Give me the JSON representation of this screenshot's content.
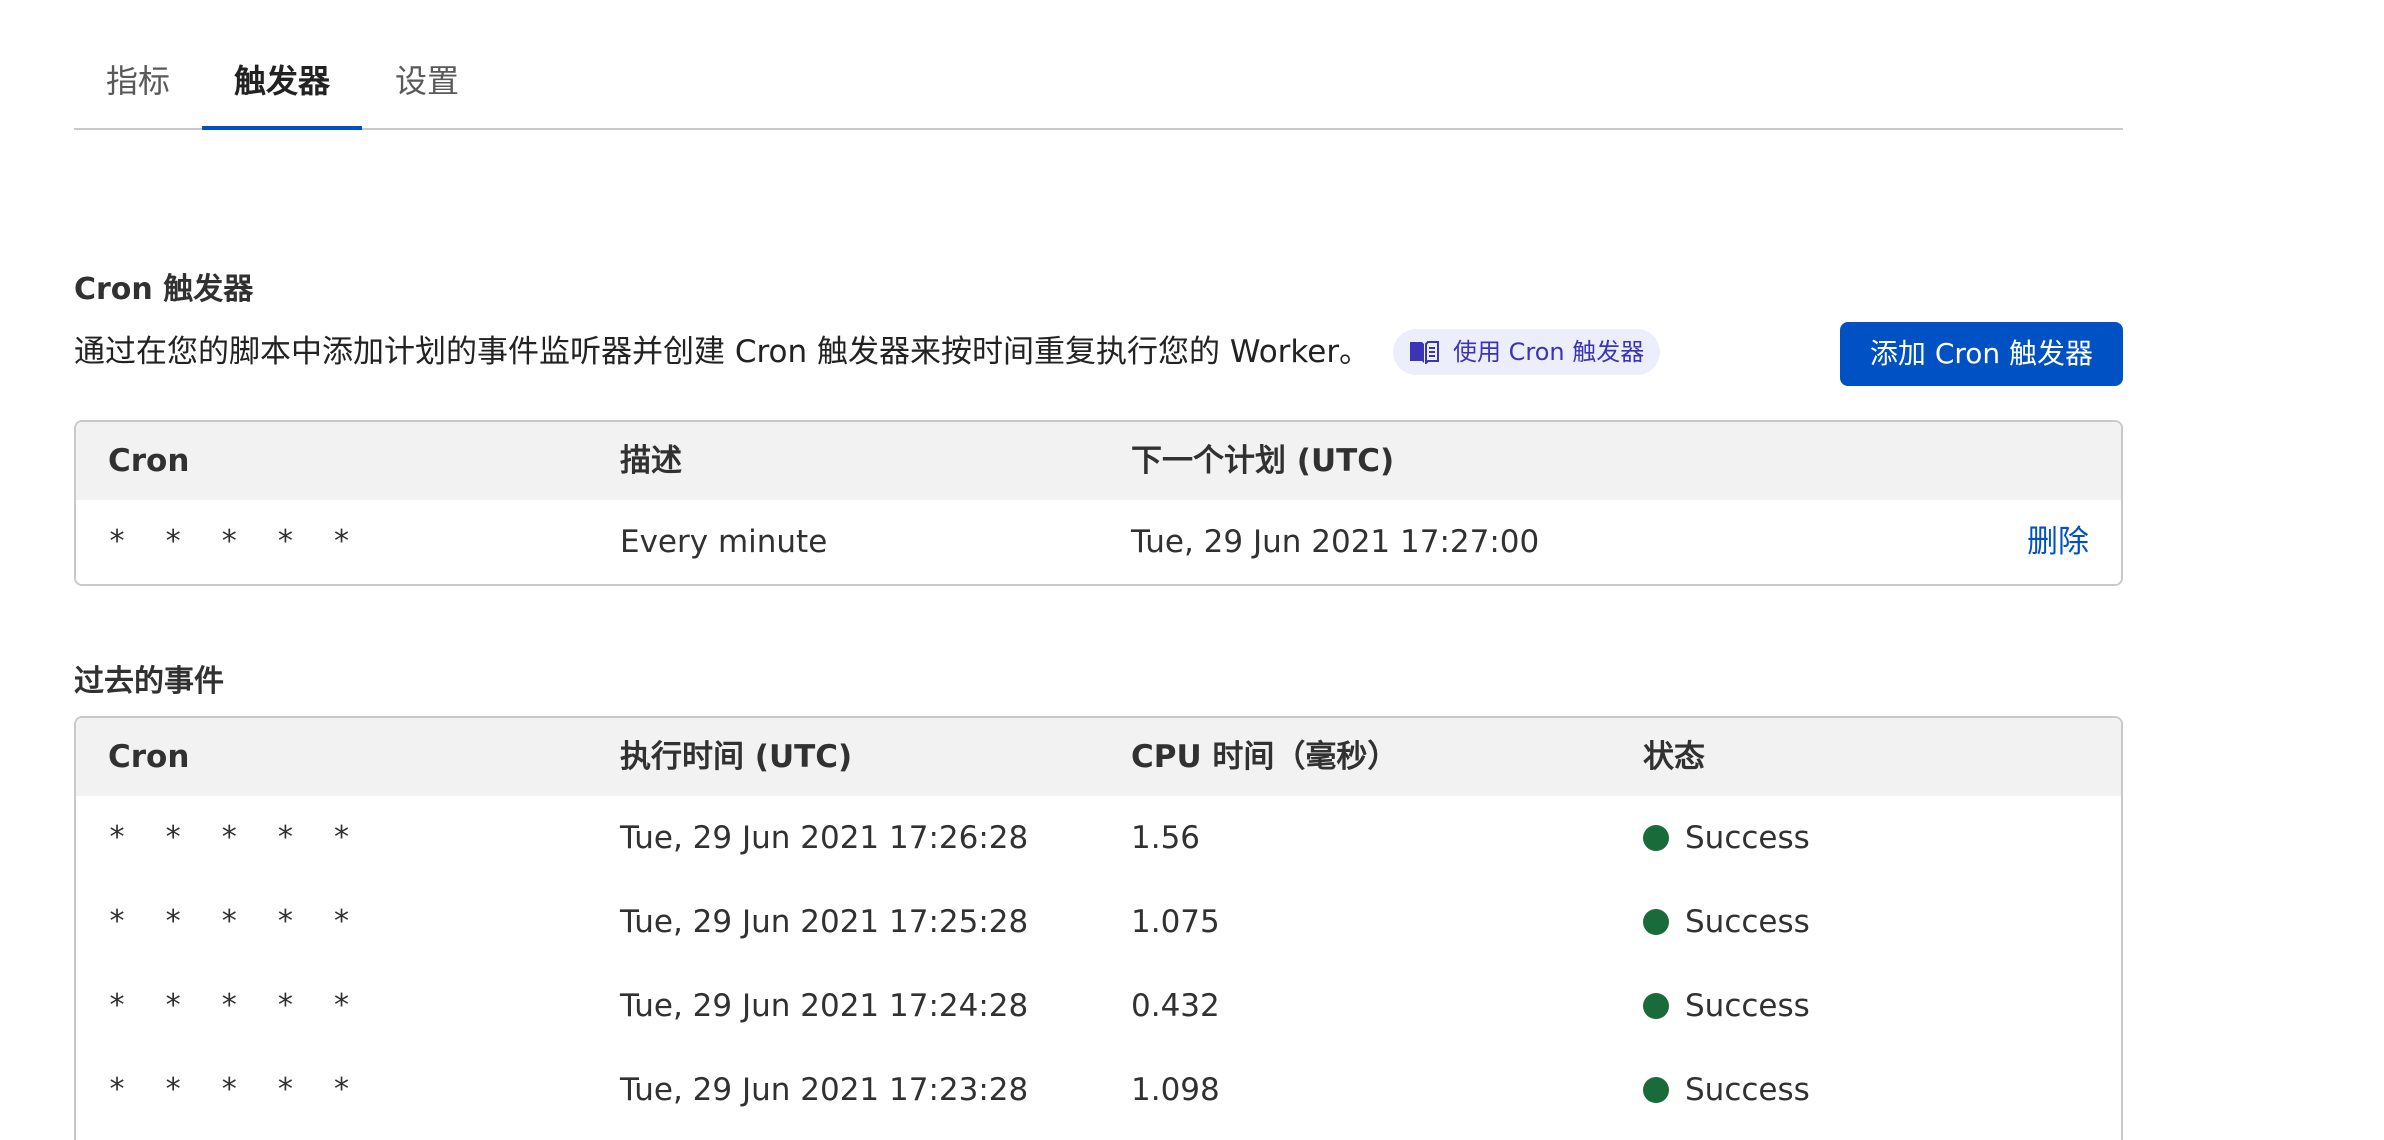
{
  "tabs": [
    {
      "label": "指标"
    },
    {
      "label": "触发器"
    },
    {
      "label": "设置"
    }
  ],
  "cron_section": {
    "title": "Cron 触发器",
    "description": "通过在您的脚本中添加计划的事件监听器并创建 Cron 触发器来按时间重复执行您的 Worker。",
    "doc_link_label": "使用 Cron 触发器",
    "doc_link_icon": "book-icon",
    "add_button_label": "添加 Cron 触发器"
  },
  "triggers_table": {
    "headers": [
      "Cron",
      "描述",
      "下一个计划 (UTC)"
    ],
    "rows": [
      {
        "cron": "* * * * *",
        "description": "Every minute",
        "next_run": "Tue, 29 Jun 2021 17:27:00",
        "action": "删除"
      }
    ]
  },
  "past_events": {
    "title": "过去的事件",
    "headers": [
      "Cron",
      "执行时间 (UTC)",
      "CPU 时间（毫秒）",
      "状态"
    ],
    "rows": [
      {
        "cron": "* * * * *",
        "executed": "Tue, 29 Jun 2021 17:26:28",
        "cpu": "1.56",
        "status": "Success"
      },
      {
        "cron": "* * * * *",
        "executed": "Tue, 29 Jun 2021 17:25:28",
        "cpu": "1.075",
        "status": "Success"
      },
      {
        "cron": "* * * * *",
        "executed": "Tue, 29 Jun 2021 17:24:28",
        "cpu": "0.432",
        "status": "Success"
      },
      {
        "cron": "* * * * *",
        "executed": "Tue, 29 Jun 2021 17:23:28",
        "cpu": "1.098",
        "status": "Success"
      }
    ]
  },
  "colors": {
    "accent": "#0051c3",
    "success": "#1a6b3a",
    "doc_link_bg": "#eceffb",
    "doc_link_text": "#3b35b5"
  }
}
